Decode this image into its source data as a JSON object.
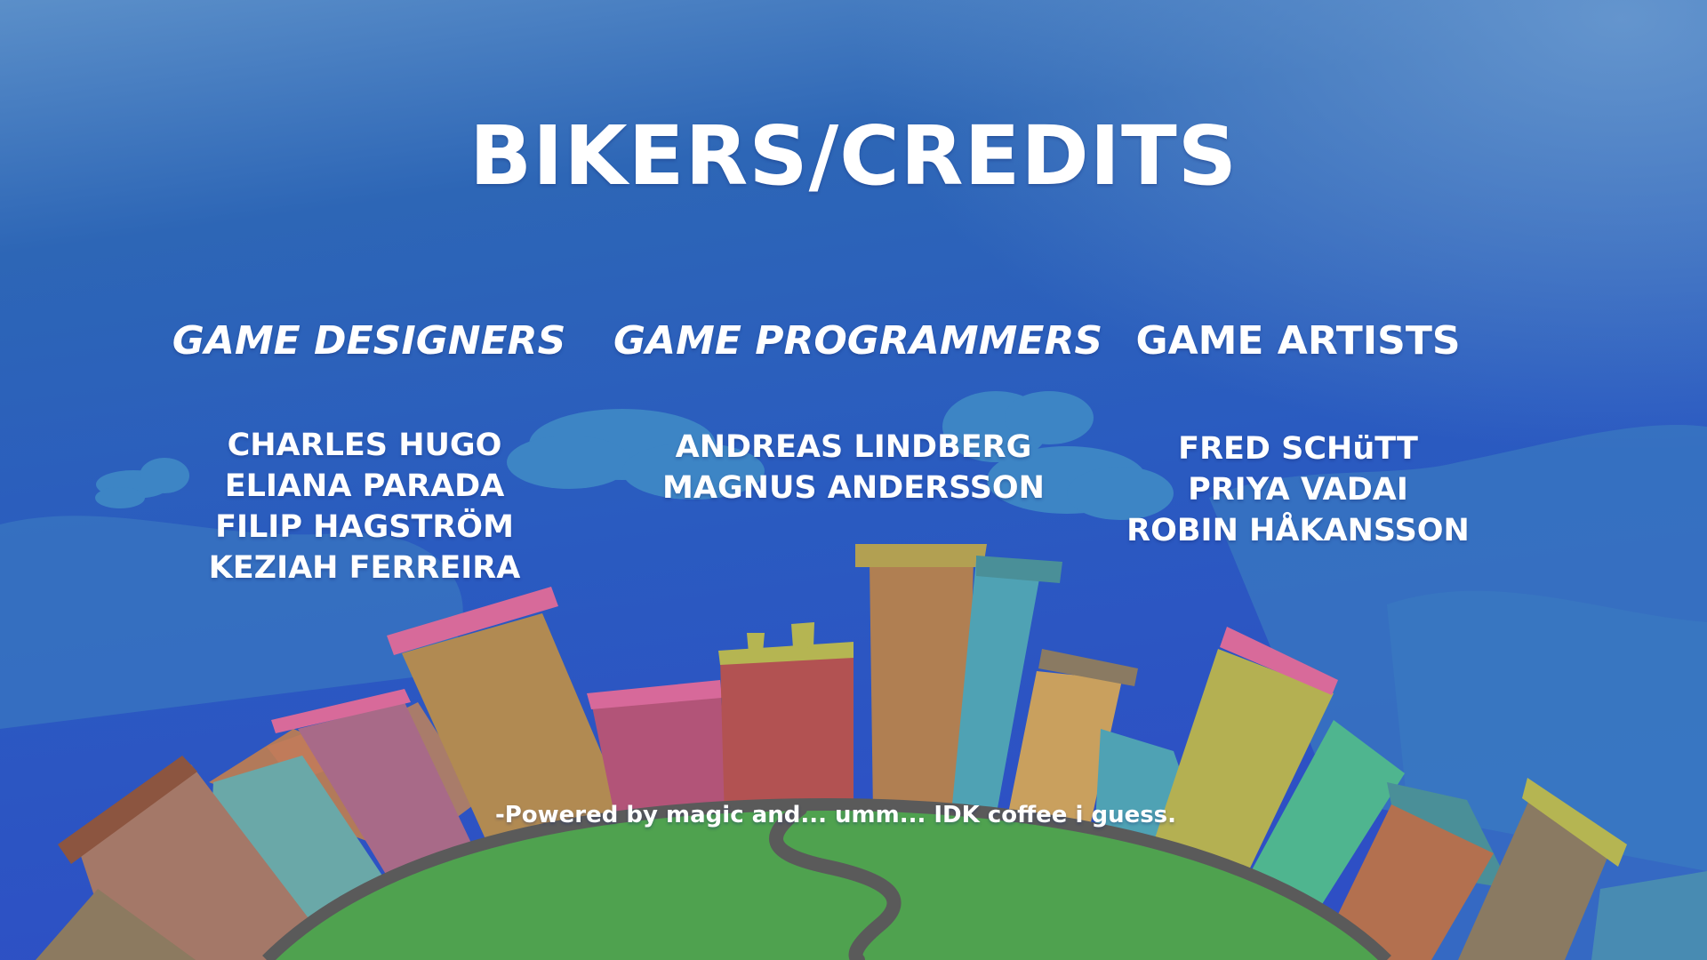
{
  "title": "BIKERS/CREDITS",
  "sections": [
    {
      "heading": "GAME DESIGNERS",
      "names": [
        "CHARLES HUGO",
        "ELIANA PARADA",
        "FILIP HAGSTRÖM",
        "KEZIAH FERREIRA"
      ]
    },
    {
      "heading": "GAME PROGRAMMERS",
      "names": [
        "ANDREAS LINDBERG",
        "MAGNUS ANDERSSON"
      ]
    },
    {
      "heading": "GAME ARTISTS",
      "names": [
        "FRED SCHüTT",
        "PRIYA VADAI",
        "ROBIN HÅKANSSON"
      ]
    }
  ],
  "footer": "-Powered by magic and... umm... IDK coffee i guess.",
  "colors": {
    "sky_top": "#4f86c6",
    "sky_mid": "#2a62b9",
    "sky_bottom": "#2d52c4",
    "cloud": "#3b86c4",
    "planet": "#4fa24f",
    "road": "#5a5a5a",
    "text": "#ffffff"
  }
}
